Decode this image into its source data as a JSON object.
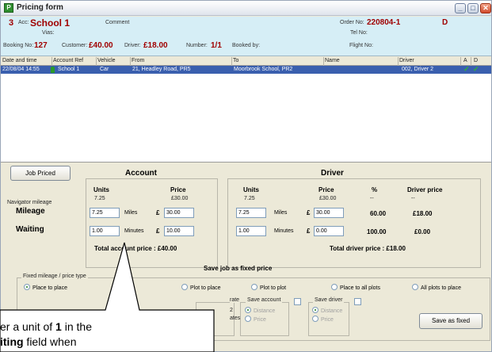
{
  "window": {
    "title": "Pricing form",
    "app_icon": "P",
    "min": "_",
    "max": "□",
    "close": "✕"
  },
  "header": {
    "line1": {
      "count": "3",
      "acc_label": "Acc:",
      "acc": "School 1",
      "comment_label": "Comment",
      "order_label": "Order No:",
      "order_no": "220804-1",
      "code": "D"
    },
    "line2": {
      "vias_label": "Vias:",
      "tel_label": "Tel No:"
    },
    "line3": {
      "booking_label": "Booking No:",
      "booking_no": "127",
      "customer_label": "Customer:",
      "customer": "£40.00",
      "driver_label": "Driver:",
      "driver": "£18.00",
      "number_label": "Number:",
      "number": "1/1",
      "booked_label": "Booked by:",
      "flight_label": "Flight No:"
    }
  },
  "table": {
    "columns": [
      "Date and time",
      "Account Ref",
      "Vehicle",
      "From",
      "To",
      "Name",
      "Driver",
      "A",
      "D"
    ],
    "rows": [
      {
        "date": "22/08/04 14:55",
        "account": "School 1",
        "vehicle": "Car",
        "from": "21, Headley Road, PR5",
        "to": "Moorbrook School, PR2",
        "name": "",
        "driver": "002, Driver 2",
        "a": "✓",
        "d": "✓"
      }
    ]
  },
  "pricing": {
    "job_priced": "Job Priced",
    "account_title": "Account",
    "driver_title": "Driver",
    "units": "Units",
    "price": "Price",
    "percent": "%",
    "driver_price": "Driver price",
    "nav_label": "Navigator mileage",
    "nav_account_units": "7.25",
    "nav_account_price": "£30.00",
    "nav_driver_units": "7.25",
    "nav_driver_price": "£30.00",
    "nav_dash1": "--",
    "nav_dash2": "--",
    "mileage_label": "Mileage",
    "waiting_label": "Waiting",
    "miles": "Miles",
    "minutes": "Minutes",
    "pound": "£",
    "acc_mileage_units": "7.25",
    "acc_mileage_price": "30.00",
    "acc_wait_units": "1.00",
    "acc_wait_price": "10.00",
    "drv_mileage_units": "7.25",
    "drv_mileage_price": "30.00",
    "drv_wait_units": "1.00",
    "drv_wait_price": "0.00",
    "drv_mileage_pct": "60.00",
    "drv_mileage_dp": "£18.00",
    "drv_wait_pct": "100.00",
    "drv_wait_dp": "£0.00",
    "total_account": "Total account price : £40.00",
    "total_driver": "Total driver price : £18.00"
  },
  "fixed": {
    "title": "Save job as fixed price",
    "group_label": "Fixed mileage / price type",
    "place_to_place": "Place to place",
    "plot_to_place": "Plot to place",
    "plot_to_plot": "Plot to plot",
    "place_to_all_plots": "Place to all plots",
    "all_plots_to_place": "All plots to place",
    "rate_label": "rate",
    "rate_2": "2",
    "rates": "ates",
    "save_account": "Save account",
    "save_driver": "Save driver",
    "distance": "Distance",
    "price": "Price",
    "save_as_fixed": "Save as fixed"
  },
  "callout": {
    "line1_pre": "er a unit of ",
    "line1_bold": "1",
    "line1_post": " in the",
    "line2_bold": "iting",
    "line2_post": " field when"
  }
}
